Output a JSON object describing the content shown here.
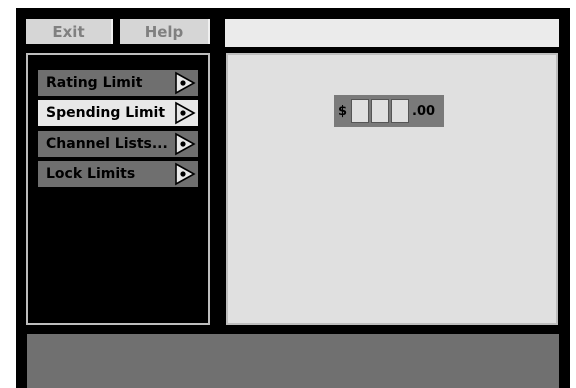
{
  "top_buttons": {
    "exit_label": "Exit",
    "help_label": "Help"
  },
  "menu": {
    "items": [
      {
        "label": "Rating Limit",
        "selected": false
      },
      {
        "label": "Spending Limit",
        "selected": true
      },
      {
        "label": "Channel Lists...",
        "selected": false
      },
      {
        "label": "Lock Limits",
        "selected": false
      }
    ]
  },
  "spending": {
    "currency_symbol": "$",
    "digits": [
      "",
      "",
      ""
    ],
    "cents_suffix": ".00"
  },
  "icons": {
    "menu_arrow": "play-dot-icon"
  },
  "colors": {
    "background": "#000000",
    "button_bg": "#d6d6d6",
    "button_text": "#808080",
    "menu_item_bg": "#6f6f6f",
    "menu_item_selected_bg": "#e8e8e8",
    "content_bg": "#e0e0e0",
    "status_bar_bg": "#707070"
  }
}
